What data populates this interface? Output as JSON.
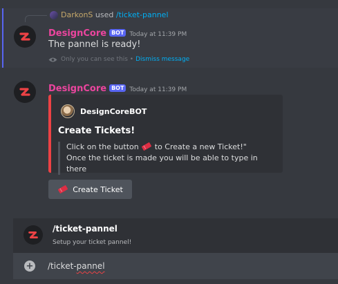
{
  "reply": {
    "user": "DarkonS",
    "used": "used",
    "command": "/ticket-pannel"
  },
  "message1": {
    "author": "DesignCore",
    "badge": "BOT",
    "timestamp": "Today at 11:39 PM",
    "text": "The pannel is ready!",
    "ephemeral_note": "Only you can see this •",
    "dismiss": "Dismiss message"
  },
  "message2": {
    "author": "DesignCore",
    "badge": "BOT",
    "timestamp": "Today at 11:39 PM",
    "embed": {
      "author": "DesignCoreBOT",
      "title": "Create Tickets!",
      "line1_a": "Click on the button",
      "line1_b": "to Create a new Ticket!\"",
      "line2": "Once the ticket is made you will be able to type in there",
      "accent_color": "#ed4245"
    },
    "button_label": "Create Ticket"
  },
  "command_popup": {
    "name": "/ticket-pannel",
    "description": "Setup your ticket pannel!"
  },
  "input": {
    "value_prefix": "/ticket-",
    "value_misspelled": "pannel"
  },
  "colors": {
    "username": "#eb459e",
    "bot_badge": "#5865f2",
    "link": "#00aff4"
  }
}
